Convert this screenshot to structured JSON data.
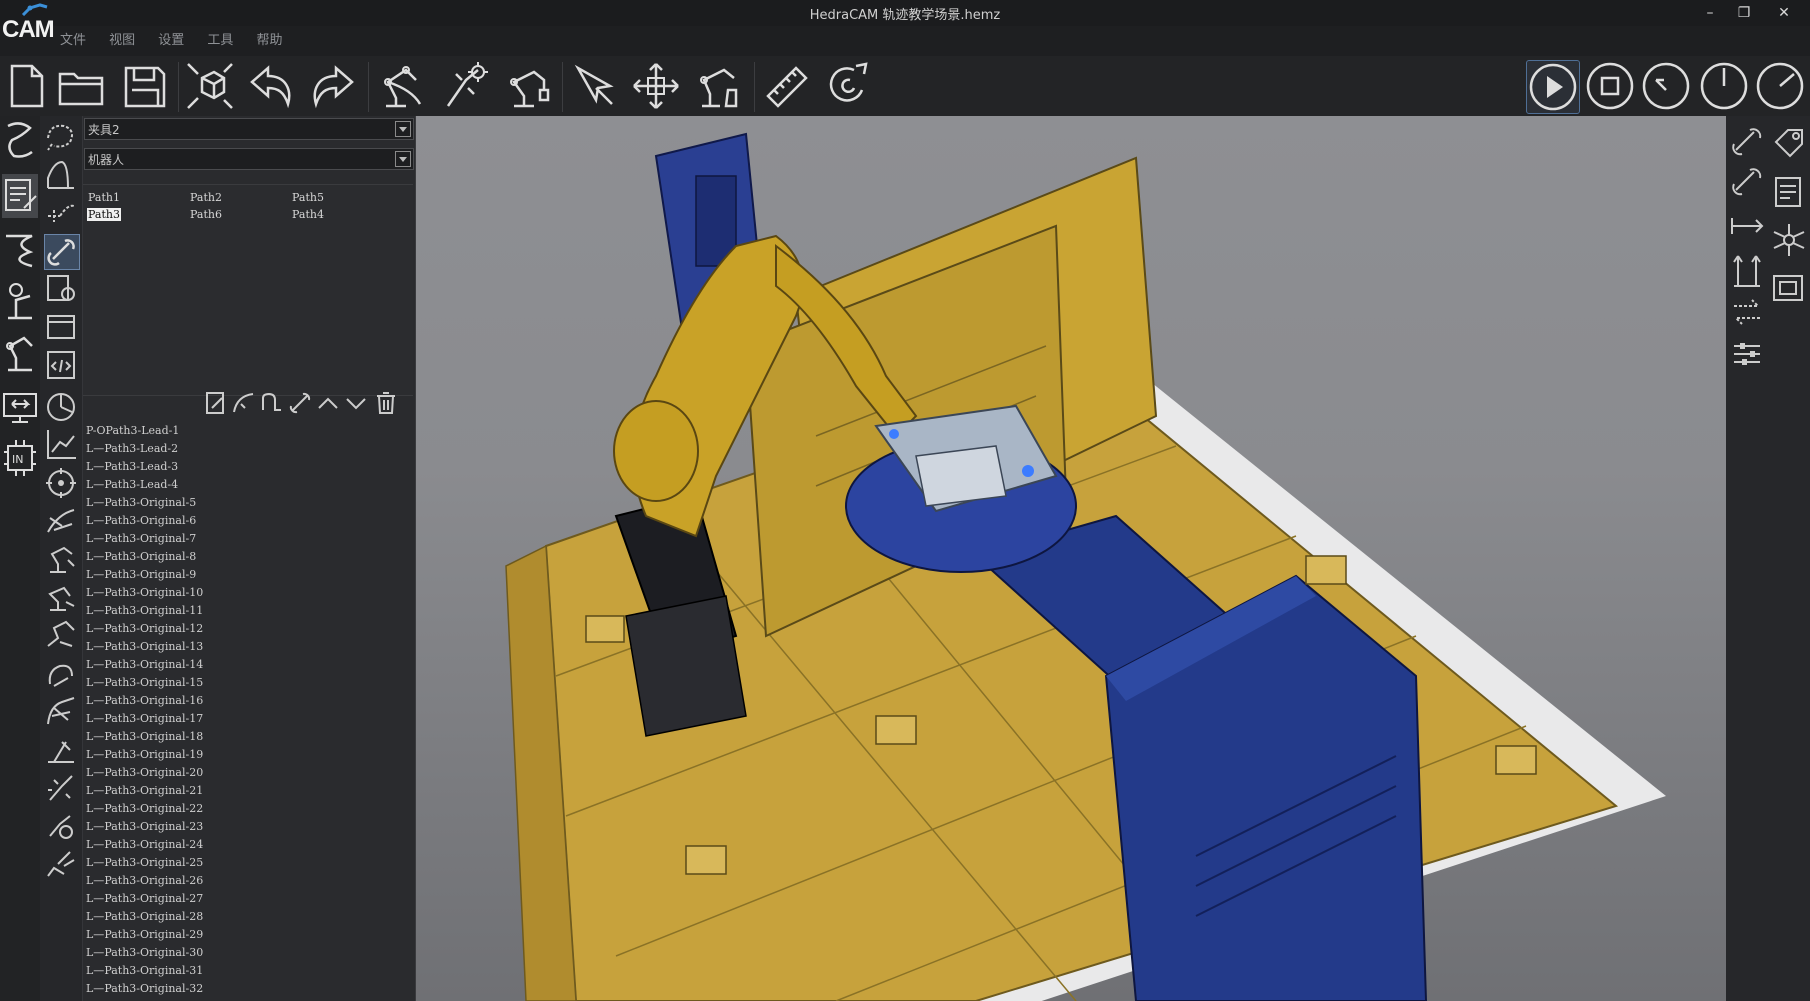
{
  "app": {
    "logo_text": "CAM",
    "window_title": "HedraCAM  轨迹教学场景.hemz"
  },
  "menu": [
    "文件",
    "视图",
    "设置",
    "工具",
    "帮助"
  ],
  "toolbar": {
    "left_icons": [
      "new-file-icon",
      "open-folder-icon",
      "save-icon",
      "fit-view-icon",
      "undo-icon",
      "redo-icon",
      "robot-path-icon",
      "robot-weld-icon",
      "robot-tool-icon",
      "select-pointer-icon",
      "move-axes-icon",
      "robot-teach-icon",
      "ruler-icon",
      "snap-magnet-icon"
    ],
    "right_icons": [
      "play-icon",
      "stop-icon",
      "rewind-icon",
      "clock-icon",
      "speed-gauge-icon"
    ]
  },
  "panel": {
    "fixture_combo": "夹具2",
    "robot_combo": "机器人",
    "paths": [
      {
        "label": "Path1",
        "selected": false
      },
      {
        "label": "Path2",
        "selected": false
      },
      {
        "label": "Path5",
        "selected": false
      },
      {
        "label": "Path3",
        "selected": true
      },
      {
        "label": "Path6",
        "selected": false
      },
      {
        "label": "Path4",
        "selected": false
      }
    ],
    "tree_root": "P-O",
    "tree_items": [
      "Path3-Lead-1",
      "Path3-Lead-2",
      "Path3-Lead-3",
      "Path3-Lead-4",
      "Path3-Original-5",
      "Path3-Original-6",
      "Path3-Original-7",
      "Path3-Original-8",
      "Path3-Original-9",
      "Path3-Original-10",
      "Path3-Original-11",
      "Path3-Original-12",
      "Path3-Original-13",
      "Path3-Original-14",
      "Path3-Original-15",
      "Path3-Original-16",
      "Path3-Original-17",
      "Path3-Original-18",
      "Path3-Original-19",
      "Path3-Original-20",
      "Path3-Original-21",
      "Path3-Original-22",
      "Path3-Original-23",
      "Path3-Original-24",
      "Path3-Original-25",
      "Path3-Original-26",
      "Path3-Original-27",
      "Path3-Original-28",
      "Path3-Original-29",
      "Path3-Original-30",
      "Path3-Original-31",
      "Path3-Original-32"
    ]
  },
  "colors": {
    "accent_select": "#4f6f96",
    "robot_yellow": "#c9a227",
    "positioner_blue": "#233a8a",
    "table_yellow": "#c7a23c"
  }
}
